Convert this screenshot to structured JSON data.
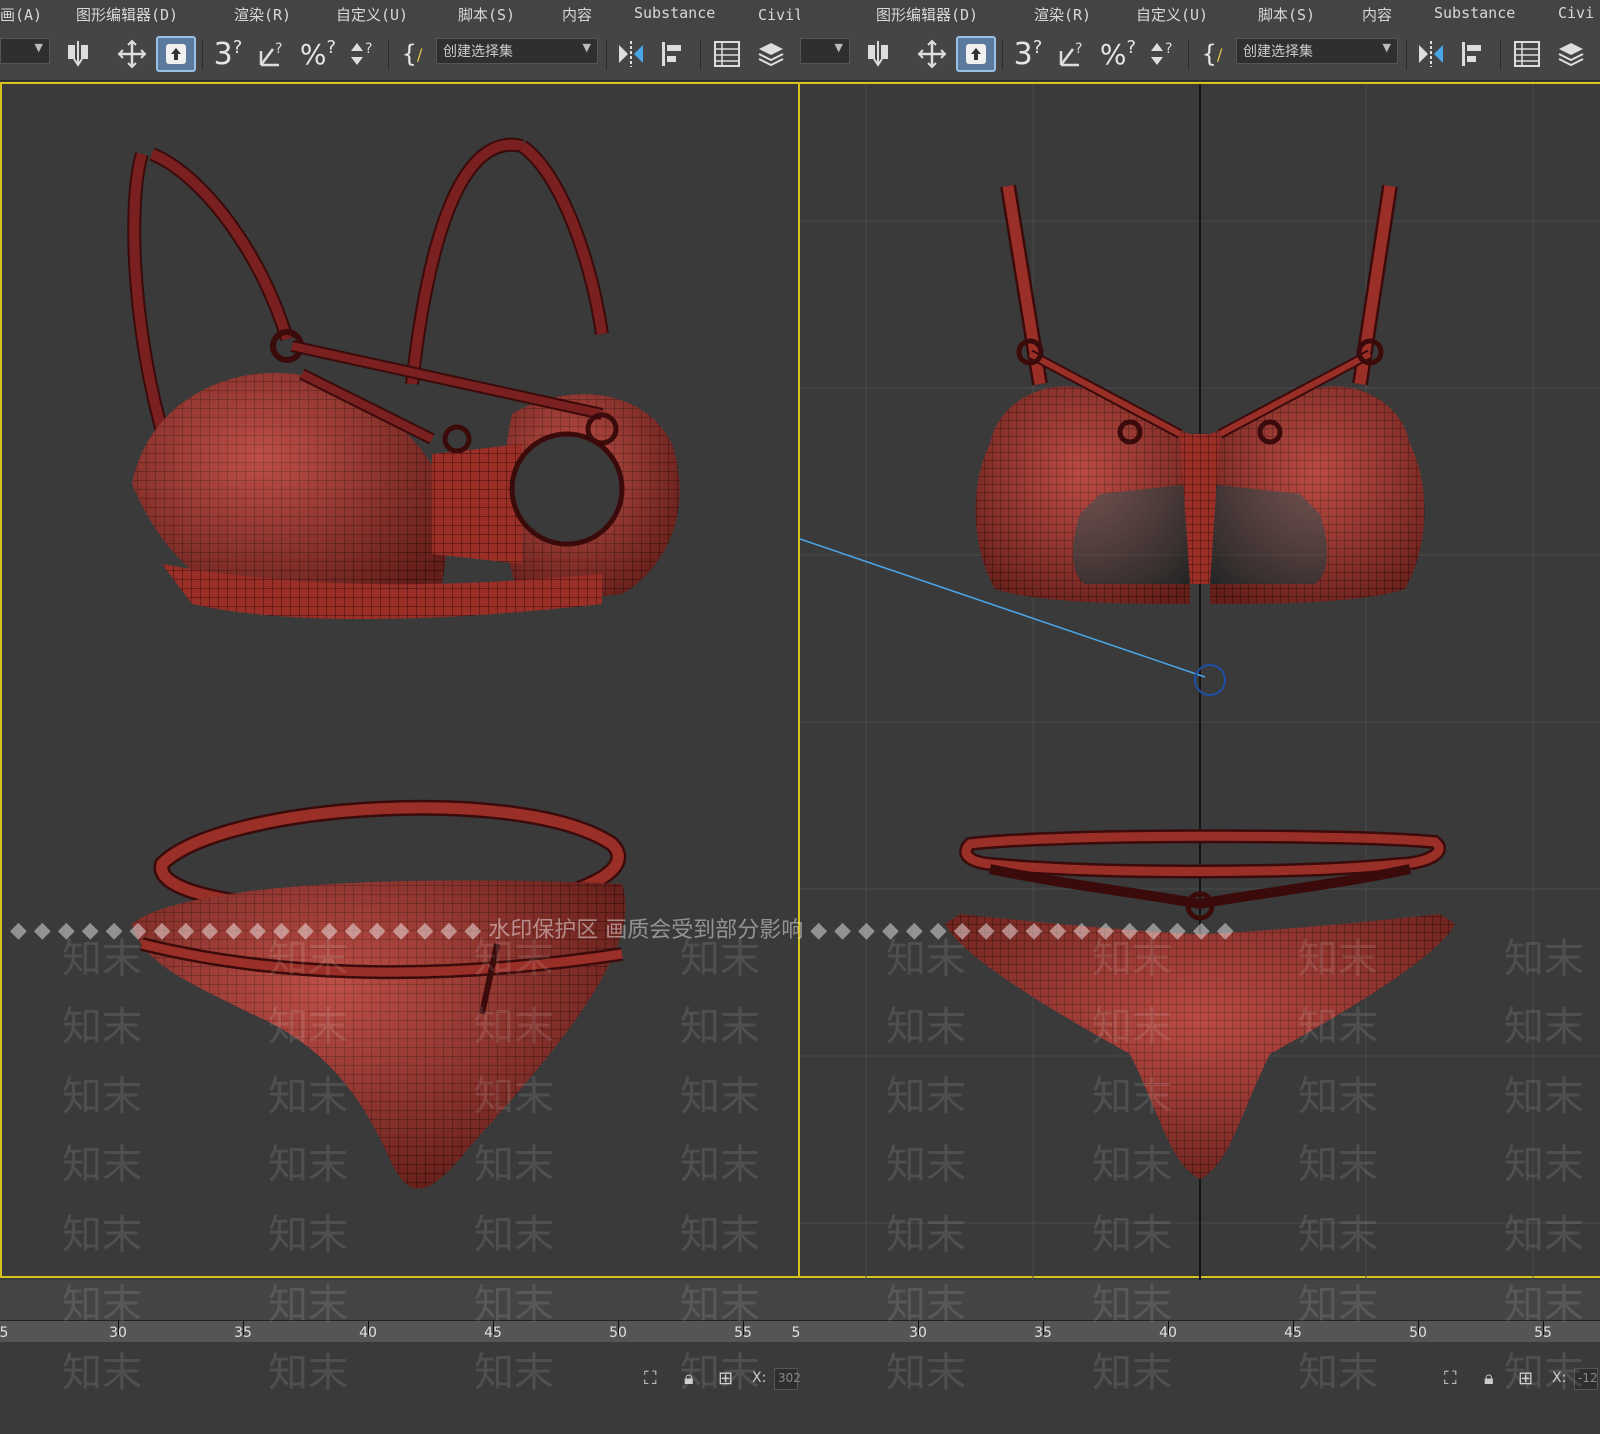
{
  "menu": {
    "items": [
      "画(A)",
      "图形编辑器(D)",
      "渲染(R)",
      "自定义(U)",
      "脚本(S)",
      "内容",
      "Substance",
      "Civil画(A)"
    ]
  },
  "menu_right": {
    "items": [
      "图形编辑器(D)",
      "渲染(R)",
      "自定义(U)",
      "脚本(S)",
      "内容",
      "Substance",
      "Civi"
    ]
  },
  "toolbar": {
    "selection_set_placeholder": "创建选择集",
    "snap_3": "3",
    "percent": "%",
    "curly": "{"
  },
  "ruler": {
    "labels_left": [
      "5",
      "30",
      "35",
      "40",
      "45",
      "50",
      "55",
      "5"
    ],
    "labels_right": [
      "30",
      "35",
      "40",
      "45",
      "50",
      "55"
    ]
  },
  "status": {
    "x_label_left": "X:",
    "x_value_left": "302",
    "x_label_right": "X:",
    "x_value_right": "-12"
  },
  "watermark": {
    "notice": "◆ ◆ ◆ ◆ ◆ ◆ ◆ ◆ ◆ ◆ ◆ ◆ ◆ ◆ ◆ ◆ ◆ ◆ ◆ ◆ 水印保护区  画质会受到部分影响 ◆ ◆ ◆ ◆ ◆ ◆ ◆ ◆ ◆ ◆ ◆ ◆ ◆ ◆ ◆ ◆ ◆ ◆",
    "text": "知末"
  },
  "colors": {
    "viewport_bg": "#3a3a3a",
    "active_border": "#d6c31f",
    "mesh_fill": "#8a2a24",
    "mesh_line": "#3a0b0a",
    "axis_line": "#141414",
    "link_line": "#4aa6e8"
  }
}
